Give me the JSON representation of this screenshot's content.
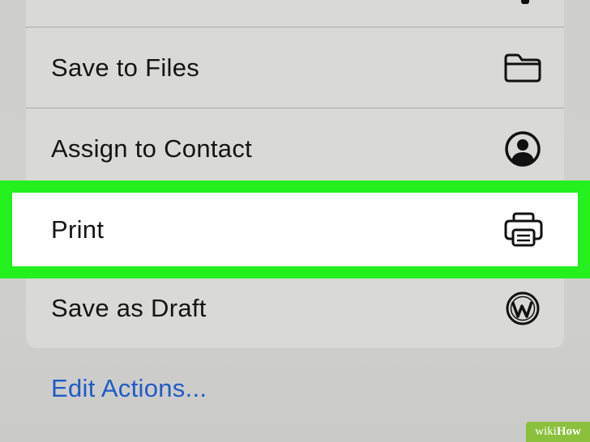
{
  "share_sheet": {
    "items": [
      {
        "label": "Save to Files",
        "icon": "folder-icon"
      },
      {
        "label": "Assign to Contact",
        "icon": "contact-icon"
      },
      {
        "label": "Print",
        "icon": "printer-icon",
        "highlighted": true
      },
      {
        "label": "Save as Draft",
        "icon": "wordpress-icon"
      }
    ],
    "edit_actions_label": "Edit Actions...",
    "highlight_color": "#23f01d",
    "link_color": "#1f5bc6"
  },
  "watermark": {
    "prefix": "wiki",
    "suffix": "How"
  }
}
